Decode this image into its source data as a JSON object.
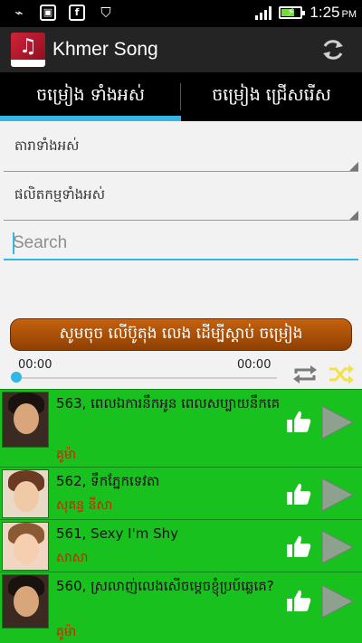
{
  "status_bar": {
    "time": "1:25",
    "ampm": "PM",
    "left_icons": [
      "usb-icon",
      "image-icon",
      "facebook-icon",
      "shield-icon"
    ]
  },
  "action_bar": {
    "title": "Khmer Song",
    "icon": "refresh-icon"
  },
  "tabs": [
    {
      "label": "ចម្រៀង ទាំងអស់",
      "selected": true
    },
    {
      "label": "ចម្រៀង ជ្រើសរើស",
      "selected": false
    }
  ],
  "filters": {
    "singer": {
      "value": "តារាទាំងអស់"
    },
    "producer": {
      "value": "ផលិតកម្មទាំងអស់"
    }
  },
  "search": {
    "placeholder": "Search",
    "value": ""
  },
  "banner": {
    "label": "សូមចុច លើប៊ូតុង លេង ដើម្បីស្ដាប់ ចម្រៀង"
  },
  "player": {
    "current_time": "00:00",
    "duration": "00:00",
    "progress": 0
  },
  "songs": [
    {
      "title": "563, ពេលឯការនឹកអូន ពេលសប្បាយនឹកគេ",
      "artist": "គូម៉ា"
    },
    {
      "title": "562, ទឹកភ្នែកទេវតា",
      "artist": "សុគន្ធ នីសា"
    },
    {
      "title": "561, Sexy I'm Shy",
      "artist": "សាសា"
    },
    {
      "title": "560, ស្រលាញ់លេងសើចម្ដេចខ្ញុំប្រប៍ឆ្លេគេ?",
      "artist": "គូម៉ា"
    }
  ],
  "colors": {
    "accent": "#33b5e5",
    "list_bg": "#18c11d",
    "artist_text": "#d81e05",
    "banner": "#b3560a"
  }
}
